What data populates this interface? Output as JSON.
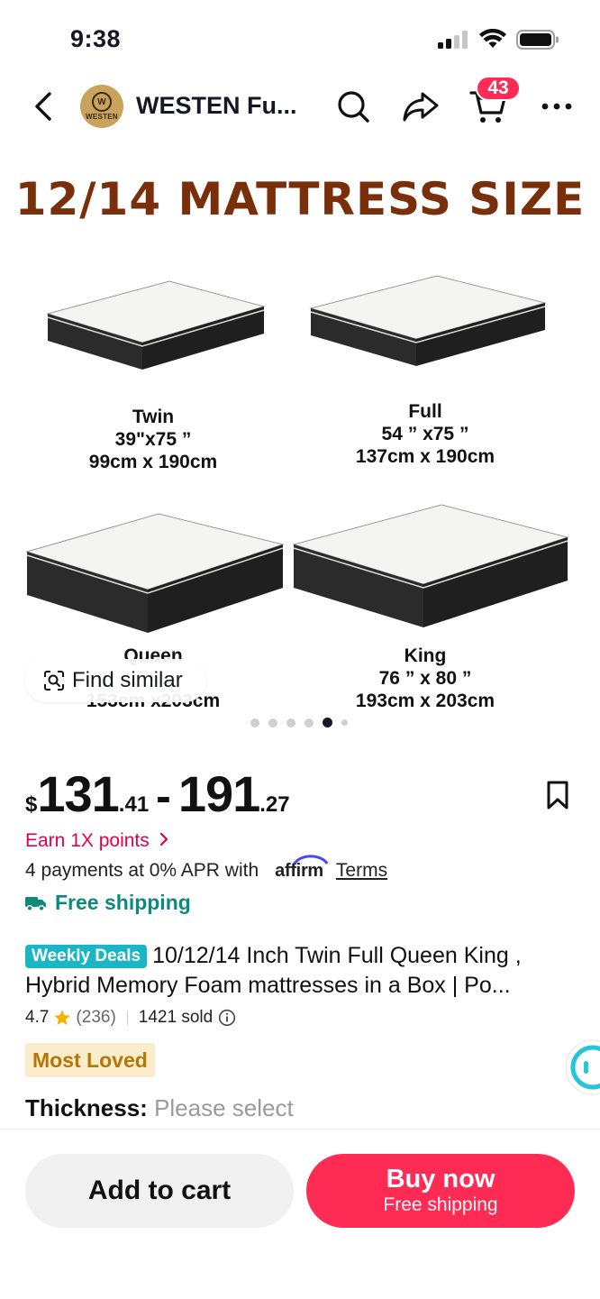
{
  "status_bar": {
    "time": "9:38"
  },
  "header": {
    "shop_name": "WESTEN Fu...",
    "shop_logo_text": "WESTEN",
    "shop_logo_mark": "W",
    "cart_count": "43",
    "icons": [
      "back-icon",
      "search-icon",
      "share-icon",
      "cart-icon",
      "more-icon"
    ]
  },
  "gallery": {
    "title": "12/14 MATTRESS SIZE",
    "sizes": [
      {
        "name": "Twin",
        "inches": "39\"x75 ”",
        "cm": "99cm x 190cm"
      },
      {
        "name": "Full",
        "inches": "54 ” x75 ”",
        "cm": "137cm x 190cm"
      },
      {
        "name": "Queen",
        "inches": "",
        "cm": "153cm x203cm"
      },
      {
        "name": "King",
        "inches": "76 ” x 80 ”",
        "cm": "193cm x 203cm"
      }
    ],
    "find_similar_label": "Find similar",
    "dots_total": 6,
    "active_dot": 5
  },
  "price": {
    "currency": "$",
    "min_whole": "131",
    "min_frac": ".41",
    "separator": "-",
    "max_whole": "191",
    "max_frac": ".27"
  },
  "earn_points": "Earn 1X points",
  "payments": {
    "text": "4 payments at 0% APR with",
    "provider": "affirm",
    "terms": "Terms"
  },
  "free_shipping": "Free shipping",
  "product": {
    "badge": "Weekly Deals",
    "title_line1": "10/12/14 Inch Twin Full Queen King ,",
    "title_line2": "Hybrid Memory Foam mattresses in a Box | Po...",
    "rating": "4.7",
    "rating_count": "(236)",
    "sold": "1421 sold",
    "tag": "Most Loved",
    "thickness_label": "Thickness:",
    "thickness_value": "Please select"
  },
  "actions": {
    "add_to_cart": "Add to cart",
    "buy_now": "Buy now",
    "buy_now_sub": "Free shipping"
  },
  "colors": {
    "accent": "#fe2c55",
    "points": "#e0004d",
    "shipping": "#0b8a7d",
    "badge": "#1bb6c6",
    "title_brown": "#7a2f0b",
    "most_loved_bg": "#fbeccb"
  }
}
